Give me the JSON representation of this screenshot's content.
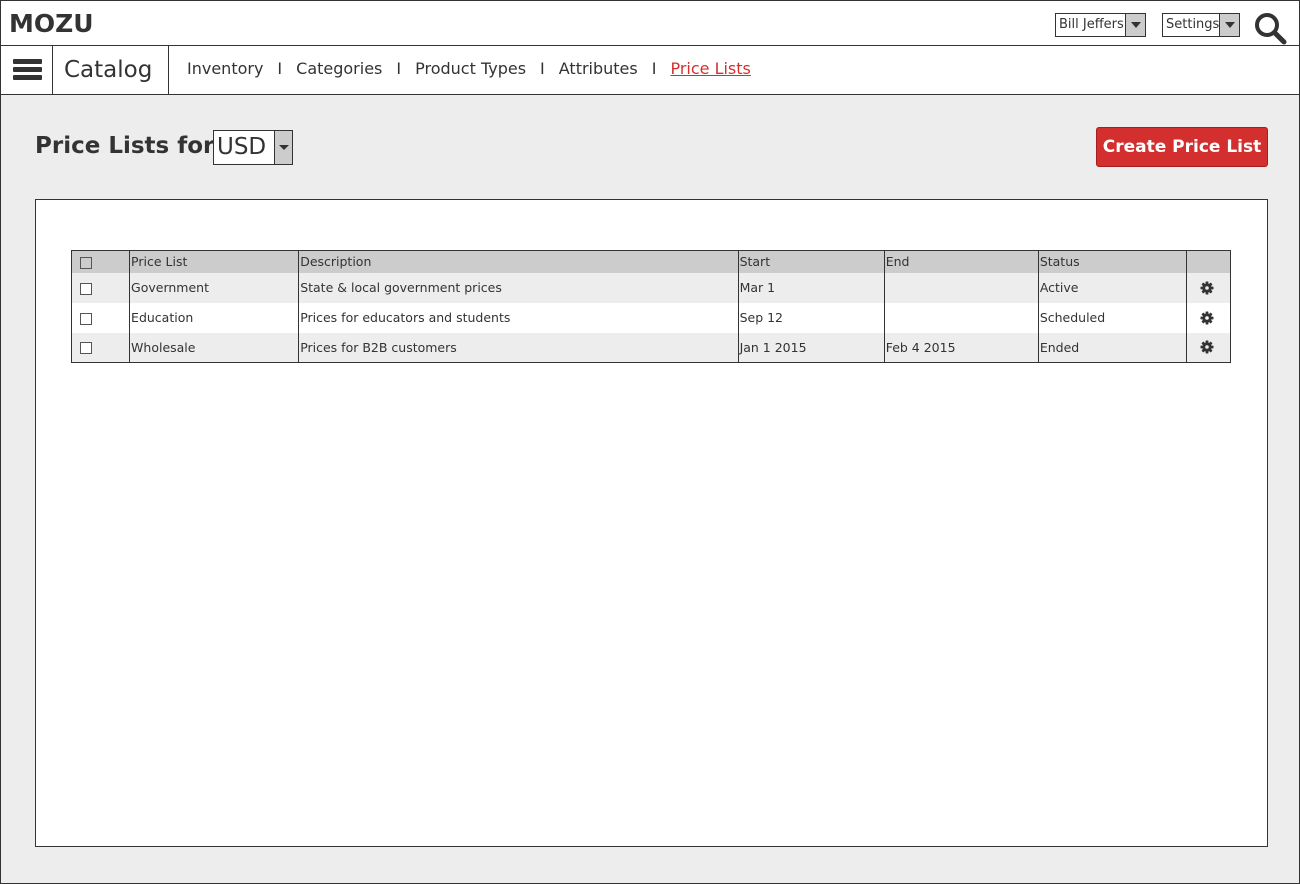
{
  "app": {
    "logo": "MOZU",
    "user_menu": "Bill Jeffers",
    "settings_menu": "Settings"
  },
  "nav": {
    "section": "Catalog",
    "links": [
      "Inventory",
      "Categories",
      "Product Types",
      "Attributes",
      "Price Lists"
    ],
    "separator": "I",
    "active": "Price Lists"
  },
  "page": {
    "title": "Price Lists for",
    "currency": "USD",
    "create_button": "Create Price List"
  },
  "table": {
    "columns": [
      "Price List",
      "Description",
      "Start",
      "End",
      "Status"
    ],
    "rows": [
      {
        "name": "Government",
        "description": "State & local government prices",
        "start": "Mar 1",
        "end": "",
        "status": "Active"
      },
      {
        "name": "Education",
        "description": "Prices for educators and students",
        "start": "Sep 12",
        "end": "",
        "status": "Scheduled"
      },
      {
        "name": "Wholesale",
        "description": "Prices for B2B customers",
        "start": "Jan 1 2015",
        "end": "Feb 4 2015",
        "status": "Ended"
      }
    ]
  },
  "icons": {
    "search": "search-icon",
    "menu": "menu-icon",
    "row_action": "gear-icon"
  },
  "colors": {
    "accent": "#d32f2f",
    "header_bg": "#cccccc",
    "page_bg": "#ededed"
  }
}
